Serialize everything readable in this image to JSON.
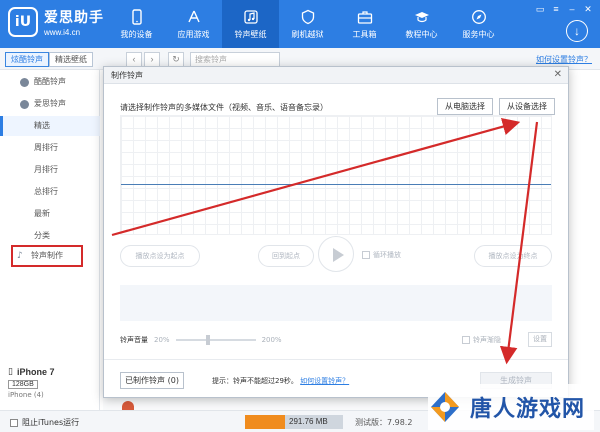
{
  "app": {
    "logo_badge": "iU",
    "name": "爱思助手",
    "url": "www.i4.cn"
  },
  "nav": {
    "items": [
      {
        "label": "我的设备",
        "icon": "phone-icon"
      },
      {
        "label": "应用游戏",
        "icon": "apps-icon"
      },
      {
        "label": "铃声壁纸",
        "icon": "music-icon"
      },
      {
        "label": "刷机越狱",
        "icon": "shield-icon"
      },
      {
        "label": "工具箱",
        "icon": "toolbox-icon"
      },
      {
        "label": "教程中心",
        "icon": "graduation-cap-icon"
      },
      {
        "label": "服务中心",
        "icon": "compass-icon"
      }
    ],
    "active_index": 2
  },
  "subbar": {
    "tab_ringtones": "炫酷铃声",
    "tab_wallpapers": "精选壁纸",
    "search_placeholder": "搜索铃声",
    "howto_link": "如何设置铃声？"
  },
  "sidebar": {
    "items": [
      {
        "label": "酷酷铃声"
      },
      {
        "label": "爱思铃声"
      },
      {
        "label": "精选"
      },
      {
        "label": "周排行"
      },
      {
        "label": "月排行"
      },
      {
        "label": "总排行"
      },
      {
        "label": "最新"
      },
      {
        "label": "分类"
      },
      {
        "label": "铃声制作"
      }
    ],
    "device": {
      "name": "iPhone 7",
      "capacity": "128GB",
      "ios": "iPhone (4)"
    }
  },
  "dialog": {
    "title": "制作铃声",
    "prompt": "请选择制作铃声的多媒体文件（视频、音乐、语音备忘录）",
    "from_pc": "从电脑选择",
    "from_device": "从设备选择",
    "set_start": "播放点设为起点",
    "back_start": "回到起点",
    "loop": "循环播放",
    "set_end": "播放点设为终点",
    "volume_label": "铃声音量",
    "vol_min": "20%",
    "vol_max": "200%",
    "fade_label": "铃声渐隐",
    "settings": "设置",
    "made_button": "已制作铃声 (0)",
    "tip": "提示：铃声不能超过29秒。",
    "tip_link": "如何设置铃声？",
    "generate": "生成铃声"
  },
  "status": {
    "block_itunes": "阻止iTunes运行",
    "storage_free": "291.76 MB",
    "storage_used_fraction": 0.4,
    "version": "测试版：7.98.2"
  },
  "watermark": {
    "text": "唐人游戏网"
  },
  "colors": {
    "header": "#2d7ee3",
    "active_nav": "#1c66c6",
    "annotation_red": "#d42a2a",
    "storage_used": "#f08c1e"
  }
}
